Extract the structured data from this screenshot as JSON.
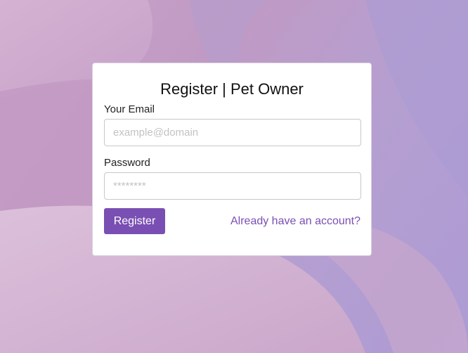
{
  "theme": {
    "accent": "#7a4fb3",
    "card_background": "#ffffff"
  },
  "form": {
    "title": "Register | Pet Owner",
    "email": {
      "label": "Your Email",
      "placeholder": "example@domain",
      "value": ""
    },
    "password": {
      "label": "Password",
      "placeholder": "********",
      "value": ""
    },
    "submit_label": "Register",
    "login_link": "Already have an account?"
  }
}
